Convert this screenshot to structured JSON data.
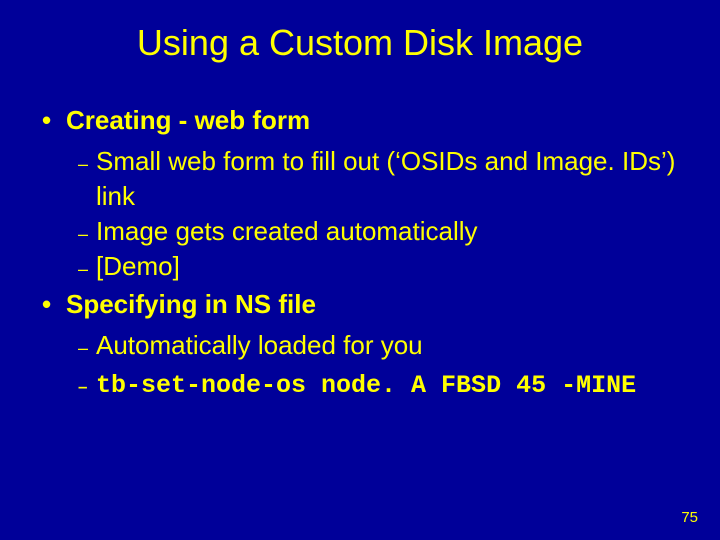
{
  "title": "Using a Custom Disk Image",
  "items": {
    "creating": {
      "heading": "Creating - web form",
      "sub1": "Small web form to fill out (‘OSIDs and Image. IDs’) link",
      "sub2": "Image gets created automatically",
      "sub3": "[Demo]"
    },
    "specifying": {
      "heading": "Specifying in NS file",
      "sub1": "Automatically loaded for you",
      "code": "tb-set-node-os node. A FBSD 45 -MINE"
    }
  },
  "page_number": "75"
}
